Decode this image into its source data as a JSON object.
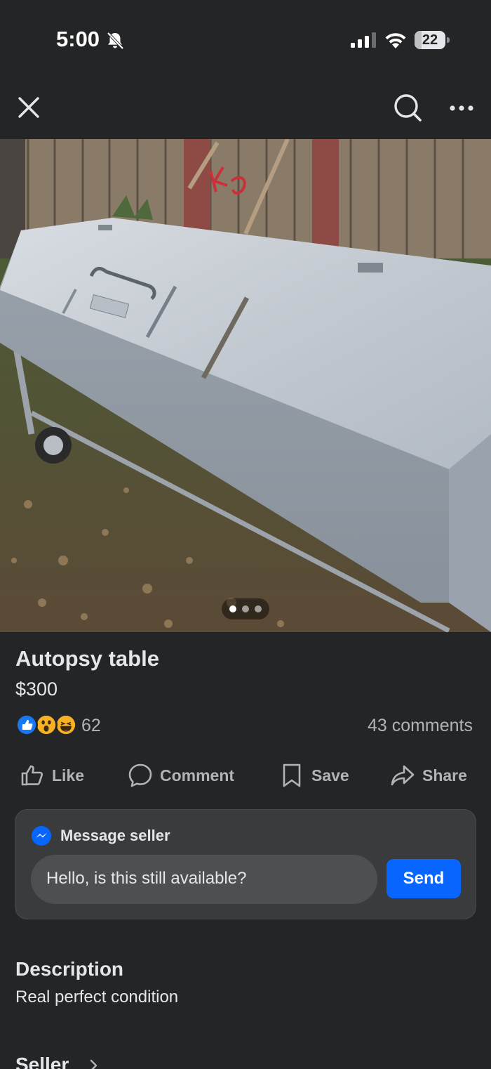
{
  "status_bar": {
    "time": "5:00",
    "battery": "22",
    "battery_level": 0.22,
    "icons": [
      "bell-off-icon",
      "cellular-signal-icon",
      "wifi-icon",
      "battery-icon"
    ]
  },
  "nav": {
    "icons": [
      "close-icon",
      "search-icon",
      "more-icon"
    ]
  },
  "carousel": {
    "total": 3,
    "active_index": 0
  },
  "listing": {
    "title": "Autopsy table",
    "price": "$300",
    "reaction_count": "62",
    "reactions": [
      "like",
      "wow",
      "haha"
    ],
    "comments": "43 comments"
  },
  "actions": {
    "like": "Like",
    "comment": "Comment",
    "save": "Save",
    "share": "Share"
  },
  "message": {
    "label": "Message seller",
    "input_value": "Hello, is this still available?",
    "send": "Send"
  },
  "description": {
    "heading": "Description",
    "text": "Real perfect condition"
  },
  "seller": {
    "heading": "Seller"
  },
  "colors": {
    "background": "#242526",
    "card": "#3a3b3c",
    "accent": "#0866ff",
    "text": "#e4e6eb",
    "muted": "#b0b3b8"
  }
}
